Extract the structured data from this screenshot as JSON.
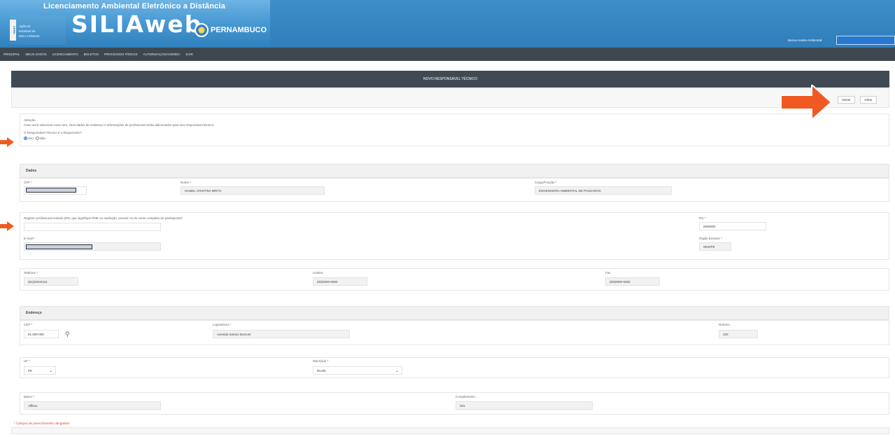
{
  "header": {
    "system_title": "Licenciamento Ambiental Eletrônico a Distância",
    "agency_badge": "CPRH",
    "agency_lines": [
      "Agência",
      "Estadual de",
      "Meio Ambiente"
    ],
    "logo": "SILIAweb",
    "state": "PERNAMBUCO",
    "key_label": "Busca Avulsa Ambiental:",
    "key_value": ""
  },
  "nav": {
    "items": [
      "PRINCIPAL",
      "MEUS DADOS",
      "LICENCIAMENTO",
      "BOLETOS",
      "PROCESSOS FÍSICOS",
      "AUTORIZAÇÃO/AGENDA",
      "SAIR"
    ]
  },
  "page": {
    "title": "NOVO RESPONSÁVEL TÉCNICO",
    "save_label": "Salvar",
    "back_label": "Voltar"
  },
  "attention": {
    "title": "Atenção",
    "message": "Caso você selecione como sim, seus dados de endereço e informações de profissional serão adicionados para seu responsável técnico.",
    "question": "O Responsável Técnico é o Requerente?",
    "option_yes": "Sim",
    "option_no": "Não",
    "selected": "Sim"
  },
  "dados": {
    "section_title": "Dados",
    "cpf_label": "CPF *",
    "nome_label": "Nome *",
    "nome_value": "ISABEL CRISTINA BRITO",
    "cargo_label": "Cargo/Função *",
    "cargo_value": "ENGENHEIRA AMBIENTAL DE PASSAROS"
  },
  "registro": {
    "question": "Registro profissional emitido (RN, que signifique RNE ou Apelação, possuir os do nome completo do passaporte)*",
    "email_label": "E-mail *",
    "rg_label": "RG *",
    "rg_value": "0000000",
    "orgao_label": "Órgão Emissor *",
    "orgao_value": "SDS/PE"
  },
  "contato": {
    "telefone_label": "Telefone *",
    "telefone_value": "(81)33343411",
    "celular_label": "Celular",
    "celular_value": "(00)0000-0000",
    "fax_label": "Fax",
    "fax_value": "(00)0000-0000"
  },
  "endereco": {
    "section_title": "Endereço",
    "cep_label": "CEP *",
    "cep_value": "51.000-000",
    "logradouro_label": "Logradouro *",
    "logradouro_value": "Avenida Santos Dumont",
    "numero_label": "Número",
    "numero_value": "100",
    "uf_label": "UF *",
    "uf_value": "PE",
    "municipio_label": "Município *",
    "municipio_value": "Recife",
    "bairro_label": "Bairro *",
    "bairro_value": "Afflitos",
    "complemento_label": "Complemento",
    "complemento_value": "201"
  },
  "footer": {
    "required_note": "* Campos de preenchimento obrigatório"
  },
  "colors": {
    "header_blue": "#3f8fc9",
    "nav_dark": "#3e4750",
    "annotation_orange": "#f05a22"
  }
}
